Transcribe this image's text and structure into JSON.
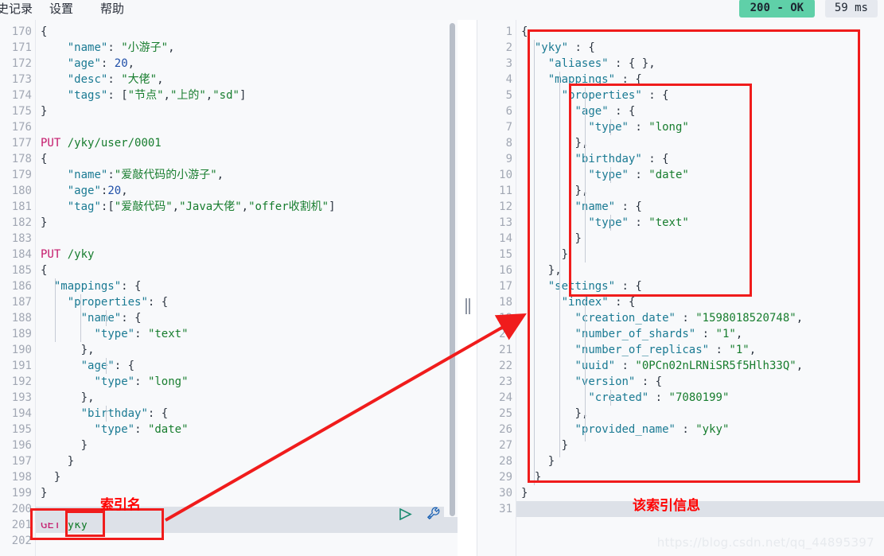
{
  "menubar": {
    "items": [
      {
        "key": "history",
        "label": "史记录"
      },
      {
        "key": "settings",
        "label": "设置"
      },
      {
        "key": "help",
        "label": "帮助"
      }
    ]
  },
  "status": {
    "code_label": "200 - OK",
    "time_label": "59 ms",
    "code_color": "#5fd0a8",
    "time_bg": "#e6e9ef"
  },
  "left_editor": {
    "first_line": 170,
    "lines": [
      {
        "no": "170",
        "fold": "▾",
        "text": "{"
      },
      {
        "no": "171",
        "fold": "",
        "text": "    \"name\": \"小游子\","
      },
      {
        "no": "172",
        "fold": "",
        "text": "    \"age\": 20,"
      },
      {
        "no": "173",
        "fold": "",
        "text": "    \"desc\": \"大佬\","
      },
      {
        "no": "174",
        "fold": "",
        "text": "    \"tags\": [\"节点\",\"上的\",\"sd\"]"
      },
      {
        "no": "175",
        "fold": "▴",
        "text": "}"
      },
      {
        "no": "176",
        "fold": "",
        "text": ""
      },
      {
        "no": "177",
        "fold": "",
        "text": "PUT /yky/user/0001"
      },
      {
        "no": "178",
        "fold": "▾",
        "text": "{"
      },
      {
        "no": "179",
        "fold": "",
        "text": "    \"name\":\"爱敲代码的小游子\","
      },
      {
        "no": "180",
        "fold": "",
        "text": "    \"age\":20,"
      },
      {
        "no": "181",
        "fold": "",
        "text": "    \"tag\":[\"爱敲代码\",\"Java大佬\",\"offer收割机\"]"
      },
      {
        "no": "182",
        "fold": "▴",
        "text": "}"
      },
      {
        "no": "183",
        "fold": "",
        "text": ""
      },
      {
        "no": "184",
        "fold": "",
        "text": "PUT /yky"
      },
      {
        "no": "185",
        "fold": "▾",
        "text": "{"
      },
      {
        "no": "186",
        "fold": "▾",
        "text": "  \"mappings\": {"
      },
      {
        "no": "187",
        "fold": "▾",
        "text": "    \"properties\": {"
      },
      {
        "no": "188",
        "fold": "▾",
        "text": "      \"name\": {"
      },
      {
        "no": "189",
        "fold": "",
        "text": "        \"type\": \"text\""
      },
      {
        "no": "190",
        "fold": "▴",
        "text": "      },"
      },
      {
        "no": "191",
        "fold": "▾",
        "text": "      \"age\": {"
      },
      {
        "no": "192",
        "fold": "",
        "text": "        \"type\": \"long\""
      },
      {
        "no": "193",
        "fold": "▴",
        "text": "      },"
      },
      {
        "no": "194",
        "fold": "▾",
        "text": "      \"birthday\": {"
      },
      {
        "no": "195",
        "fold": "",
        "text": "        \"type\": \"date\""
      },
      {
        "no": "196",
        "fold": "▴",
        "text": "      }"
      },
      {
        "no": "197",
        "fold": "▴",
        "text": "    }"
      },
      {
        "no": "198",
        "fold": "▴",
        "text": "  }"
      },
      {
        "no": "199",
        "fold": "▴",
        "text": "}"
      },
      {
        "no": "200",
        "fold": "",
        "text": ""
      },
      {
        "no": "201",
        "fold": "",
        "text": "GET yky",
        "highlight": true,
        "verb": "GET",
        "path": "yky"
      },
      {
        "no": "202",
        "fold": "",
        "text": ""
      }
    ]
  },
  "right_editor": {
    "lines": [
      {
        "no": "1",
        "fold": "▾",
        "text": "{"
      },
      {
        "no": "2",
        "fold": "▾",
        "text": "  \"yky\" : {"
      },
      {
        "no": "3",
        "fold": "",
        "text": "    \"aliases\" : { },"
      },
      {
        "no": "4",
        "fold": "▾",
        "text": "    \"mappings\" : {"
      },
      {
        "no": "5",
        "fold": "▾",
        "text": "      \"properties\" : {"
      },
      {
        "no": "6",
        "fold": "▾",
        "text": "        \"age\" : {"
      },
      {
        "no": "7",
        "fold": "",
        "text": "          \"type\" : \"long\""
      },
      {
        "no": "8",
        "fold": "▴",
        "text": "        },"
      },
      {
        "no": "9",
        "fold": "▾",
        "text": "        \"birthday\" : {"
      },
      {
        "no": "10",
        "fold": "",
        "text": "          \"type\" : \"date\""
      },
      {
        "no": "11",
        "fold": "▴",
        "text": "        },"
      },
      {
        "no": "12",
        "fold": "▾",
        "text": "        \"name\" : {"
      },
      {
        "no": "13",
        "fold": "",
        "text": "          \"type\" : \"text\""
      },
      {
        "no": "14",
        "fold": "▴",
        "text": "        }"
      },
      {
        "no": "15",
        "fold": "▴",
        "text": "      }"
      },
      {
        "no": "16",
        "fold": "▴",
        "text": "    },"
      },
      {
        "no": "17",
        "fold": "▾",
        "text": "    \"settings\" : {"
      },
      {
        "no": "18",
        "fold": "▾",
        "text": "      \"index\" : {"
      },
      {
        "no": "19",
        "fold": "",
        "text": "        \"creation_date\" : \"1598018520748\","
      },
      {
        "no": "20",
        "fold": "",
        "text": "        \"number_of_shards\" : \"1\","
      },
      {
        "no": "21",
        "fold": "",
        "text": "        \"number_of_replicas\" : \"1\","
      },
      {
        "no": "22",
        "fold": "",
        "text": "        \"uuid\" : \"0PCn02nLRNiSR5f5Hlh33Q\","
      },
      {
        "no": "23",
        "fold": "▾",
        "text": "        \"version\" : {"
      },
      {
        "no": "24",
        "fold": "",
        "text": "          \"created\" : \"7080199\""
      },
      {
        "no": "25",
        "fold": "▴",
        "text": "        },"
      },
      {
        "no": "26",
        "fold": "",
        "text": "        \"provided_name\" : \"yky\""
      },
      {
        "no": "27",
        "fold": "▴",
        "text": "      }"
      },
      {
        "no": "28",
        "fold": "▴",
        "text": "    }"
      },
      {
        "no": "29",
        "fold": "▴",
        "text": "  }"
      },
      {
        "no": "30",
        "fold": "▴",
        "text": "}"
      },
      {
        "no": "31",
        "fold": "",
        "text": "",
        "highlight": true
      }
    ]
  },
  "annotations": {
    "index_name_label": "索引名",
    "index_info_label": "该索引信息",
    "color": "#ff0000"
  },
  "toolbar": {
    "play_title": "run",
    "wrench_title": "tools"
  },
  "watermark": "https://blog.csdn.net/qq_44895397"
}
